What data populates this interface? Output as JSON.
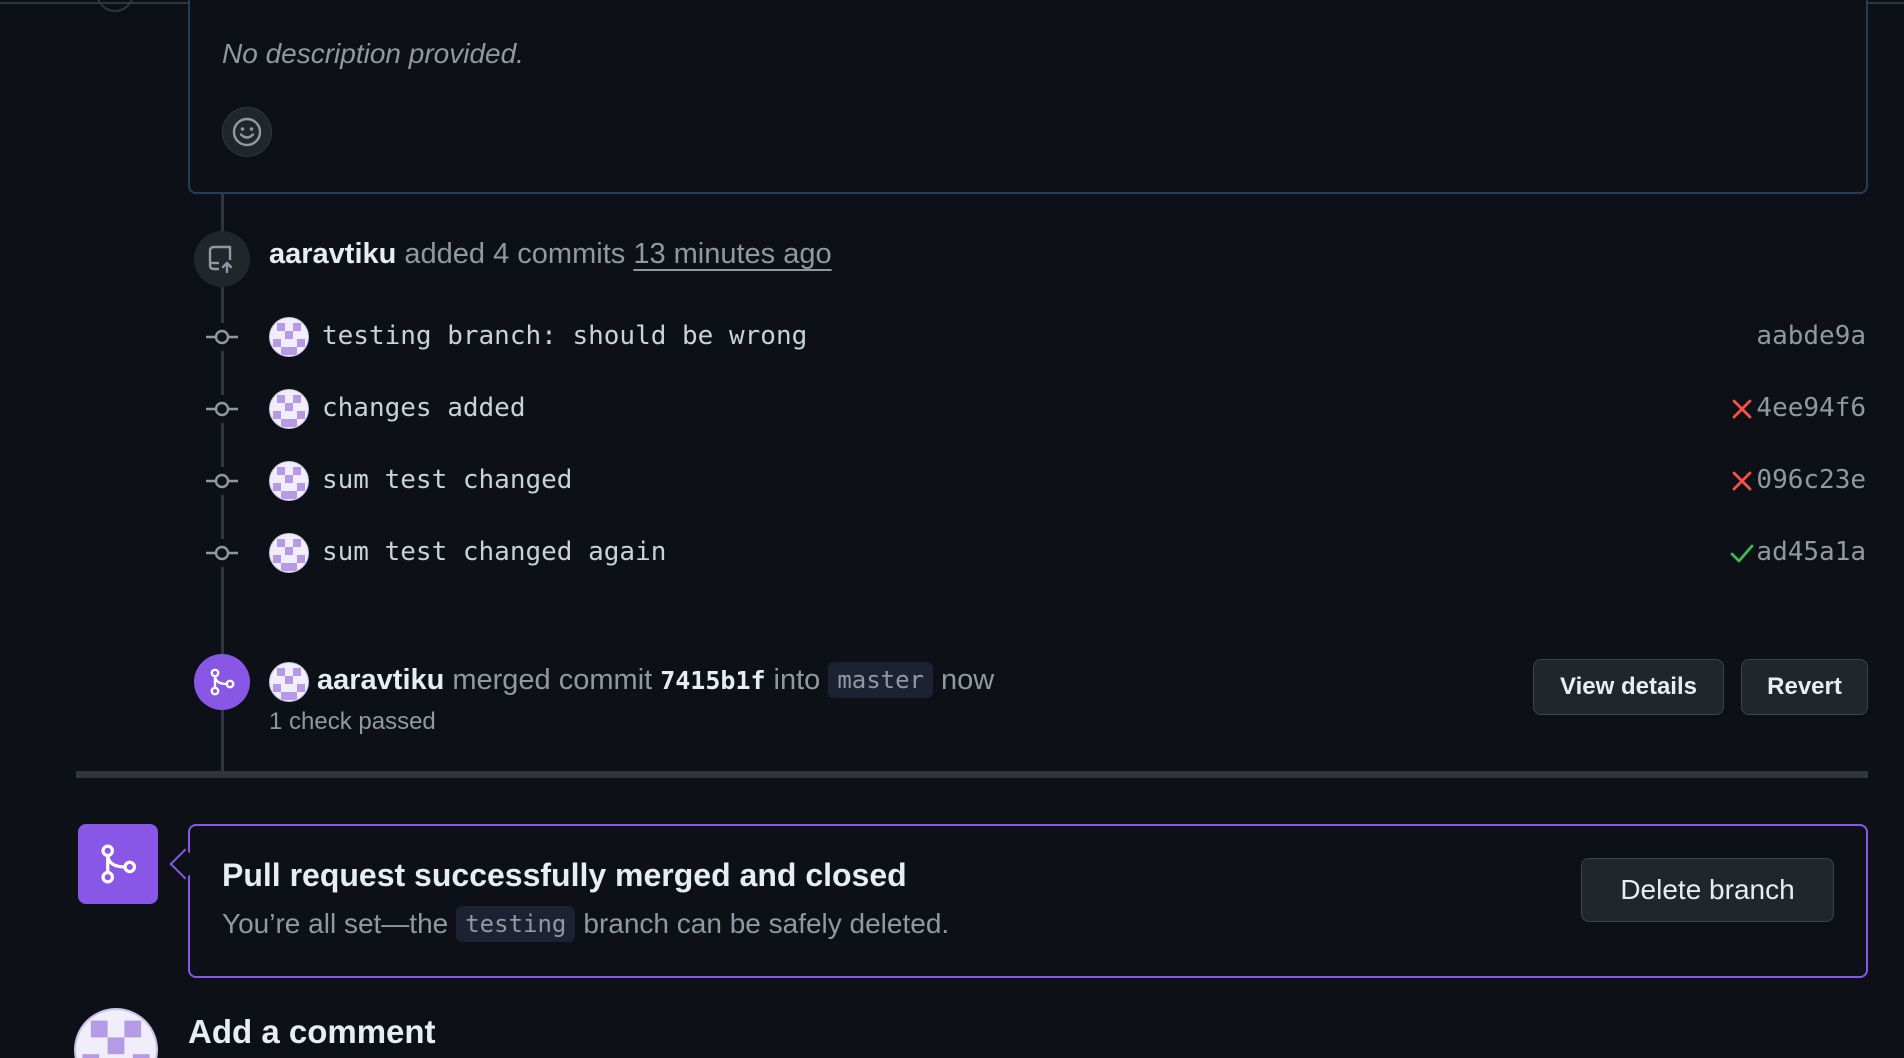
{
  "description": {
    "text": "No description provided."
  },
  "commits_event": {
    "user": "aaravtiku",
    "action": "added 4 commits",
    "time": "13 minutes ago"
  },
  "commits": [
    {
      "message": "testing branch: should be wrong",
      "sha": "aabde9a",
      "status": "none"
    },
    {
      "message": "changes added",
      "sha": "4ee94f6",
      "status": "failure"
    },
    {
      "message": "sum test changed",
      "sha": "096c23e",
      "status": "failure"
    },
    {
      "message": "sum test changed again",
      "sha": "ad45a1a",
      "status": "success"
    }
  ],
  "merge_event": {
    "user": "aaravtiku",
    "action": "merged commit",
    "sha": "7415b1f",
    "into": "into",
    "branch": "master",
    "time": "now",
    "checks": "1 check passed",
    "view_details_label": "View details",
    "revert_label": "Revert"
  },
  "merged_box": {
    "title": "Pull request successfully merged and closed",
    "sub_prefix": "You’re all set—the",
    "branch": "testing",
    "sub_suffix": "branch can be safely deleted.",
    "delete_label": "Delete branch"
  },
  "add_comment": {
    "title": "Add a comment"
  },
  "colors": {
    "background": "#0d1117",
    "merged_purple": "#8957e5",
    "failure_red": "#f85149",
    "success_green": "#3fb950",
    "muted_text": "#9198a1"
  }
}
